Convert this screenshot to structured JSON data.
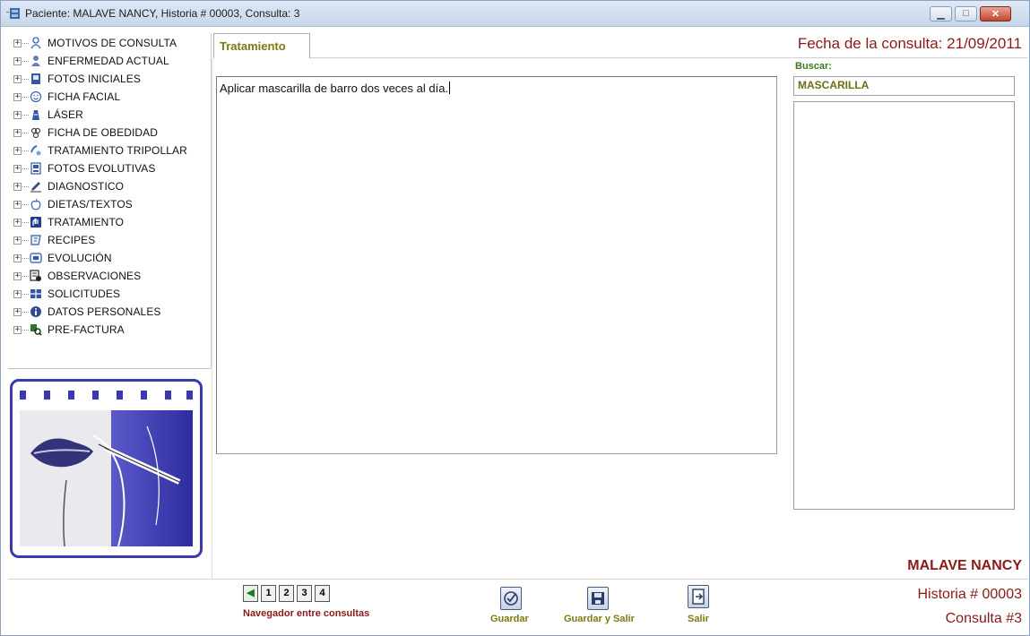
{
  "window": {
    "title": "Paciente: MALAVE  NANCY, Historia # 00003, Consulta: 3",
    "minimize_glyph": "▁",
    "maximize_glyph": "□",
    "close_glyph": "✕"
  },
  "tree": {
    "expander_glyph": "+",
    "items": [
      {
        "label": "MOTIVOS DE CONSULTA",
        "icon": "person-outline-icon"
      },
      {
        "label": "ENFERMEDAD ACTUAL",
        "icon": "person-icon"
      },
      {
        "label": "FOTOS INICIALES",
        "icon": "photo-icon"
      },
      {
        "label": "FICHA FACIAL",
        "icon": "smiley-face-icon"
      },
      {
        "label": "LÁSER",
        "icon": "laser-icon"
      },
      {
        "label": "FICHA DE OBEDIDAD",
        "icon": "scale-icon"
      },
      {
        "label": "TRATAMIENTO TRIPOLLAR",
        "icon": "tripollar-icon"
      },
      {
        "label": "FOTOS EVOLUTIVAS",
        "icon": "photos-icon"
      },
      {
        "label": "DIAGNOSTICO",
        "icon": "pen-icon"
      },
      {
        "label": "DIETAS/TEXTOS",
        "icon": "apple-icon"
      },
      {
        "label": "TRATAMIENTO",
        "icon": "treatment-icon"
      },
      {
        "label": "RECIPES",
        "icon": "recipe-icon"
      },
      {
        "label": "EVOLUCIÓN",
        "icon": "evolution-icon"
      },
      {
        "label": "OBSERVACIONES",
        "icon": "observations-icon"
      },
      {
        "label": "SOLICITUDES",
        "icon": "grid-icon"
      },
      {
        "label": "DATOS PERSONALES",
        "icon": "info-icon"
      },
      {
        "label": "PRE-FACTURA",
        "icon": "magnifier-icon"
      }
    ]
  },
  "tab": {
    "label": "Tratamiento"
  },
  "consult_date": "Fecha de la consulta: 21/09/2011",
  "treatment_text": "Aplicar mascarilla de barro dos veces al día.",
  "search": {
    "label": "Buscar:",
    "value": "MASCARILLA"
  },
  "patient": {
    "name": "MALAVE NANCY",
    "historia": "Historia # 00003",
    "consulta": "Consulta #3"
  },
  "navigator": {
    "first_glyph": "◀",
    "pages": [
      "1",
      "2",
      "3",
      "4"
    ],
    "label": "Navegador entre consultas"
  },
  "actions": {
    "save": "Guardar",
    "save_exit": "Guardar y Salir",
    "exit": "Salir"
  },
  "colors": {
    "accent_red": "#8b1919",
    "accent_olive": "#7c7a12",
    "logo_blue": "#3a3ab0"
  }
}
